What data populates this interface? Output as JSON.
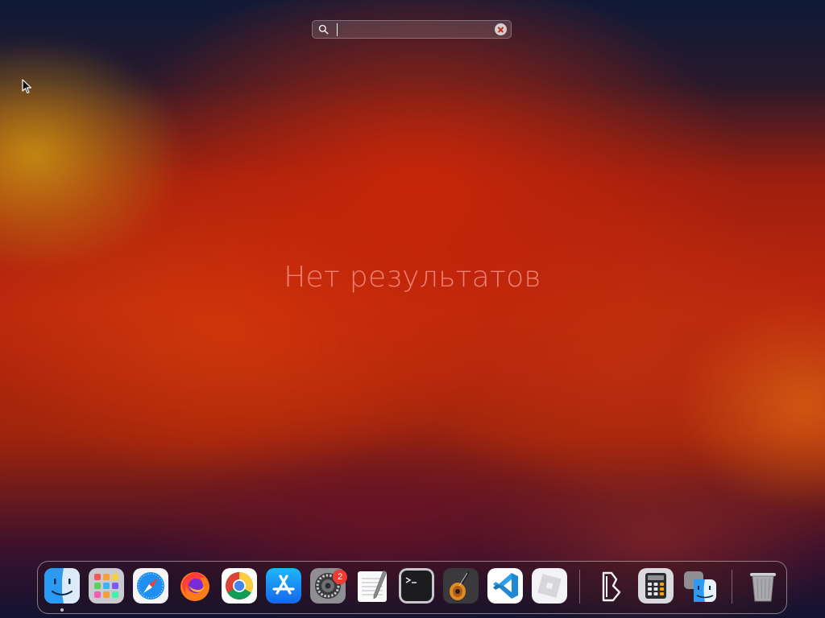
{
  "search": {
    "value": "",
    "placeholder": ""
  },
  "message": {
    "no_results": "Нет результатов"
  },
  "dock": {
    "items": [
      {
        "name": "Finder",
        "icon": "finder-icon",
        "running": true
      },
      {
        "name": "Launchpad",
        "icon": "launchpad-icon",
        "running": false
      },
      {
        "name": "Safari",
        "icon": "safari-icon",
        "running": false
      },
      {
        "name": "Firefox",
        "icon": "firefox-icon",
        "running": false
      },
      {
        "name": "Google Chrome",
        "icon": "chrome-icon",
        "running": false
      },
      {
        "name": "App Store",
        "icon": "app-store-icon",
        "running": false
      },
      {
        "name": "System Preferences",
        "icon": "system-preferences-icon",
        "running": false,
        "badge": "2"
      },
      {
        "name": "TextEdit",
        "icon": "textedit-icon",
        "running": false
      },
      {
        "name": "Terminal",
        "icon": "terminal-icon",
        "running": false
      },
      {
        "name": "GarageBand",
        "icon": "garageband-icon",
        "running": false
      },
      {
        "name": "Visual Studio Code",
        "icon": "vscode-icon",
        "running": false
      },
      {
        "name": "Roblox",
        "icon": "roblox-icon",
        "running": false
      },
      {
        "name": "Bitwig",
        "icon": "bitwig-icon",
        "running": false
      },
      {
        "name": "Calculator",
        "icon": "calculator-icon",
        "running": false
      },
      {
        "name": "Migration Assistant",
        "icon": "migration-assistant-icon",
        "running": false
      },
      {
        "name": "Trash",
        "icon": "trash-icon",
        "running": false
      }
    ]
  },
  "colors": {
    "badge": "#ef3b32",
    "no_results_text": "#ff9f96"
  }
}
